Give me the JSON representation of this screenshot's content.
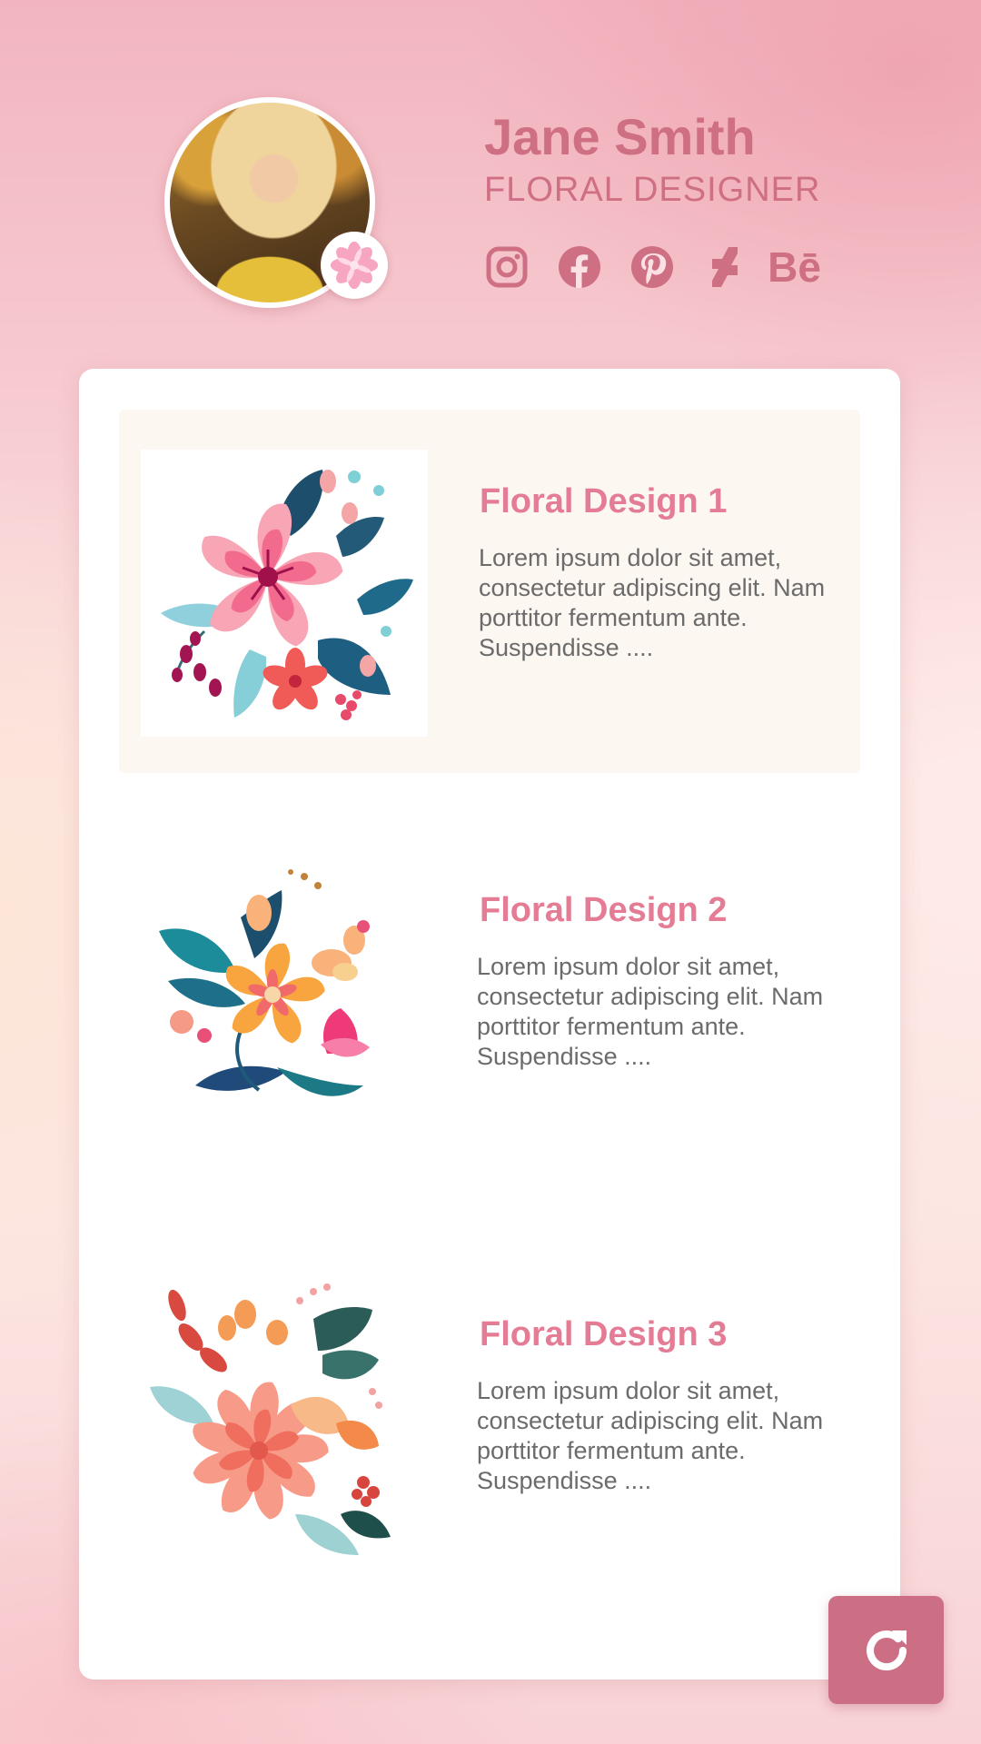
{
  "profile": {
    "name": "Jane Smith",
    "role": "FLORAL DESIGNER",
    "avatar_icon": "portrait-photo",
    "badge_icon": "pinwheel-flower-icon"
  },
  "socials": [
    {
      "name": "instagram",
      "icon": "instagram-icon"
    },
    {
      "name": "facebook",
      "icon": "facebook-icon"
    },
    {
      "name": "pinterest",
      "icon": "pinterest-icon"
    },
    {
      "name": "deviantart",
      "icon": "deviantart-icon"
    },
    {
      "name": "behance",
      "icon": "behance-icon",
      "label": "Bē"
    }
  ],
  "gallery": {
    "items": [
      {
        "title": "Floral Design 1",
        "description": "Lorem ipsum dolor sit amet, consectetur adipiscing elit. Nam porttitor fermentum ante. Suspendisse ....",
        "highlighted": true
      },
      {
        "title": "Floral Design 2",
        "description": "Lorem ipsum dolor sit amet, consectetur adipiscing elit. Nam porttitor fermentum ante. Suspendisse ....",
        "highlighted": false
      },
      {
        "title": "Floral Design 3",
        "description": "Lorem ipsum dolor sit amet, consectetur adipiscing elit. Nam porttitor fermentum ante. Suspendisse ....",
        "highlighted": false
      }
    ]
  },
  "actions": {
    "refresh_icon": "refresh-icon"
  },
  "colors": {
    "accent": "#cf6f84",
    "title_pink": "#e47c95",
    "text_gray": "#6b6b6b",
    "refresh_button": "#cc6f85",
    "highlight_bg": "#fdf7f2"
  }
}
